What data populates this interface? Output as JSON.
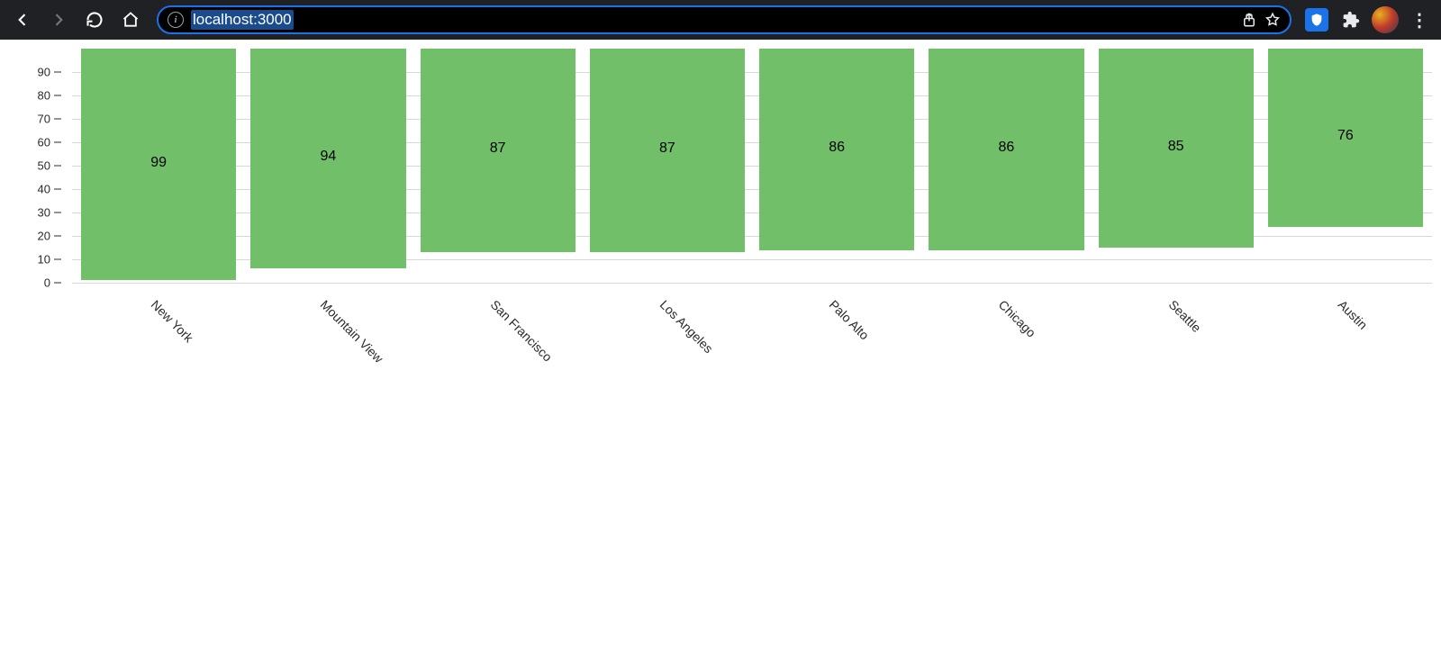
{
  "browser": {
    "url": "localhost:3000"
  },
  "chart_data": {
    "type": "bar",
    "categories": [
      "New York",
      "Mountain View",
      "San Francisco",
      "Los Angeles",
      "Palo Alto",
      "Chicago",
      "Seattle",
      "Austin"
    ],
    "values": [
      99,
      94,
      87,
      87,
      86,
      86,
      85,
      76
    ],
    "title": "",
    "xlabel": "",
    "ylabel": "",
    "ylim": [
      0,
      100
    ],
    "yticks": [
      0,
      10,
      20,
      30,
      40,
      50,
      60,
      70,
      80,
      90
    ],
    "bar_color": "#72bf6a",
    "grid_color": "#d8d8d8"
  }
}
